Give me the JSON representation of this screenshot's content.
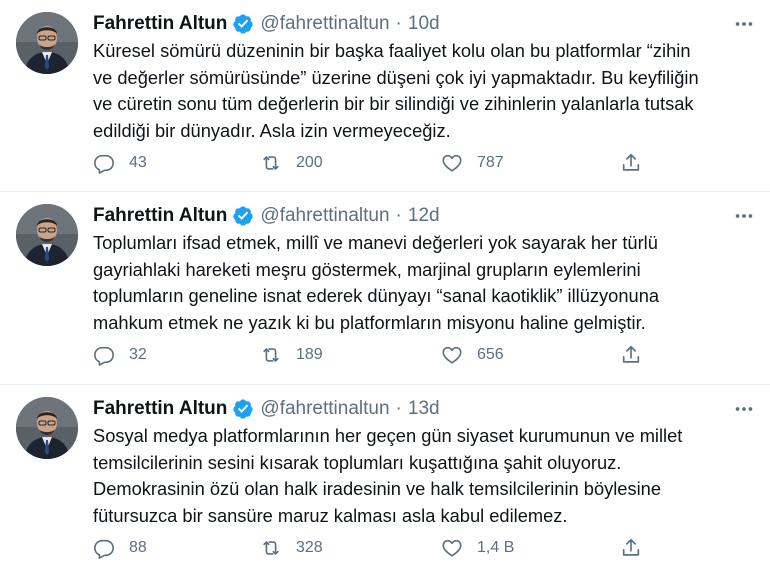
{
  "colors": {
    "text_primary": "#0f1419",
    "text_secondary": "#5b7083",
    "verified_badge": "#1da1f2",
    "divider": "#e6ecf0"
  },
  "icons": {
    "verified": "verified-badge-icon",
    "more": "more-options-icon",
    "reply": "reply-icon",
    "retweet": "retweet-icon",
    "like": "heart-icon",
    "share": "share-icon"
  },
  "tweets": [
    {
      "name": "Fahrettin Altun",
      "handle": "@fahrettinaltun",
      "separator": "·",
      "time": "10d",
      "text": "Küresel sömürü düzeninin bir başka faaliyet kolu olan bu platformlar “zihin\nve değerler sömürüsünde” üzerine düşeni çok iyi yapmaktadır. Bu keyfiliğin\nve cüretin sonu tüm değerlerin bir bir silindiği ve zihinlerin yalanlarla tutsak\nedildiği bir dünyadır. Asla izin vermeyeceğiz.",
      "replies": "43",
      "retweets": "200",
      "likes": "787"
    },
    {
      "name": "Fahrettin Altun",
      "handle": "@fahrettinaltun",
      "separator": "·",
      "time": "12d",
      "text": "Toplumları ifsad etmek, millî ve manevi değerleri yok sayarak her türlü\ngayriahlaki hareketi meşru göstermek, marjinal grupların eylemlerini\ntoplumların geneline isnat ederek dünyayı “sanal kaotiklik” illüzyonuna\nmahkum etmek ne yazık ki bu platformların misyonu haline gelmiştir.",
      "replies": "32",
      "retweets": "189",
      "likes": "656"
    },
    {
      "name": "Fahrettin Altun",
      "handle": "@fahrettinaltun",
      "separator": "·",
      "time": "13d",
      "text": "Sosyal medya platformlarının her geçen gün siyaset kurumunun ve millet\ntemsilcilerinin sesini kısarak toplumları kuşattığına şahit oluyoruz.\nDemokrasinin özü olan halk iradesinin ve halk temsilcilerinin böylesine\nfütursuzca bir sansüre maruz kalması asla kabul edilemez.",
      "replies": "88",
      "retweets": "328",
      "likes": "1,4 B"
    }
  ]
}
